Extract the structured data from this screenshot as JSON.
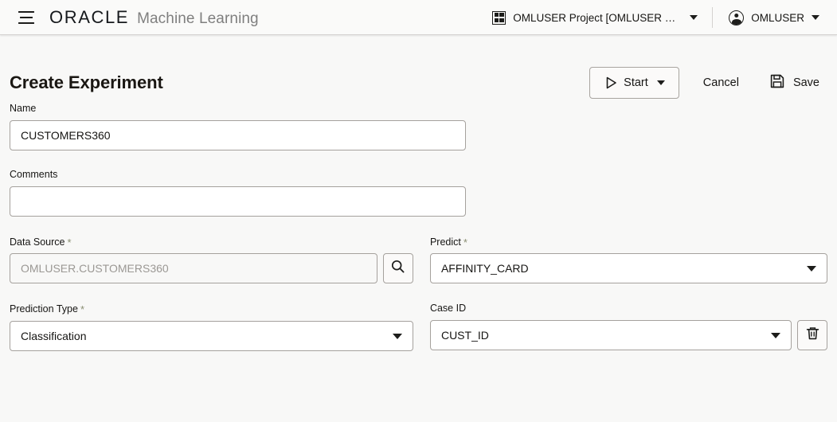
{
  "header": {
    "menu_icon": "hamburger-menu-icon",
    "brand_primary": "ORACLE",
    "brand_secondary": "Machine Learning",
    "project": {
      "icon": "grid-icon",
      "label": "OMLUSER Project [OMLUSER Works...",
      "caret_icon": "chevron-down-icon"
    },
    "user": {
      "icon": "user-avatar-icon",
      "label": "OMLUSER",
      "caret_icon": "chevron-down-icon"
    }
  },
  "page": {
    "title": "Create Experiment",
    "actions": {
      "start_label": "Start",
      "start_icon": "play-icon",
      "start_caret_icon": "chevron-down-icon",
      "cancel_label": "Cancel",
      "save_label": "Save",
      "save_icon": "floppy-disk-icon"
    }
  },
  "form": {
    "name": {
      "label": "Name",
      "value": "CUSTOMERS360",
      "placeholder": ""
    },
    "comments": {
      "label": "Comments",
      "value": "",
      "placeholder": ""
    },
    "data_source": {
      "label": "Data Source",
      "required": "*",
      "value": "",
      "placeholder": "OMLUSER.CUSTOMERS360",
      "search_icon": "search-icon"
    },
    "predict": {
      "label": "Predict",
      "required": "*",
      "value": "AFFINITY_CARD",
      "caret_icon": "chevron-down-icon"
    },
    "prediction_type": {
      "label": "Prediction Type",
      "required": "*",
      "value": "Classification",
      "caret_icon": "chevron-down-icon"
    },
    "case_id": {
      "label": "Case ID",
      "value": "CUST_ID",
      "caret_icon": "chevron-down-icon",
      "delete_icon": "trash-icon"
    }
  },
  "colors": {
    "page_bg": "#f8f8f7",
    "header_bg": "#fafaf9",
    "border": "#a5a19d",
    "text": "#161513",
    "muted_text": "#9b9894",
    "required_star": "#8a8f73"
  }
}
